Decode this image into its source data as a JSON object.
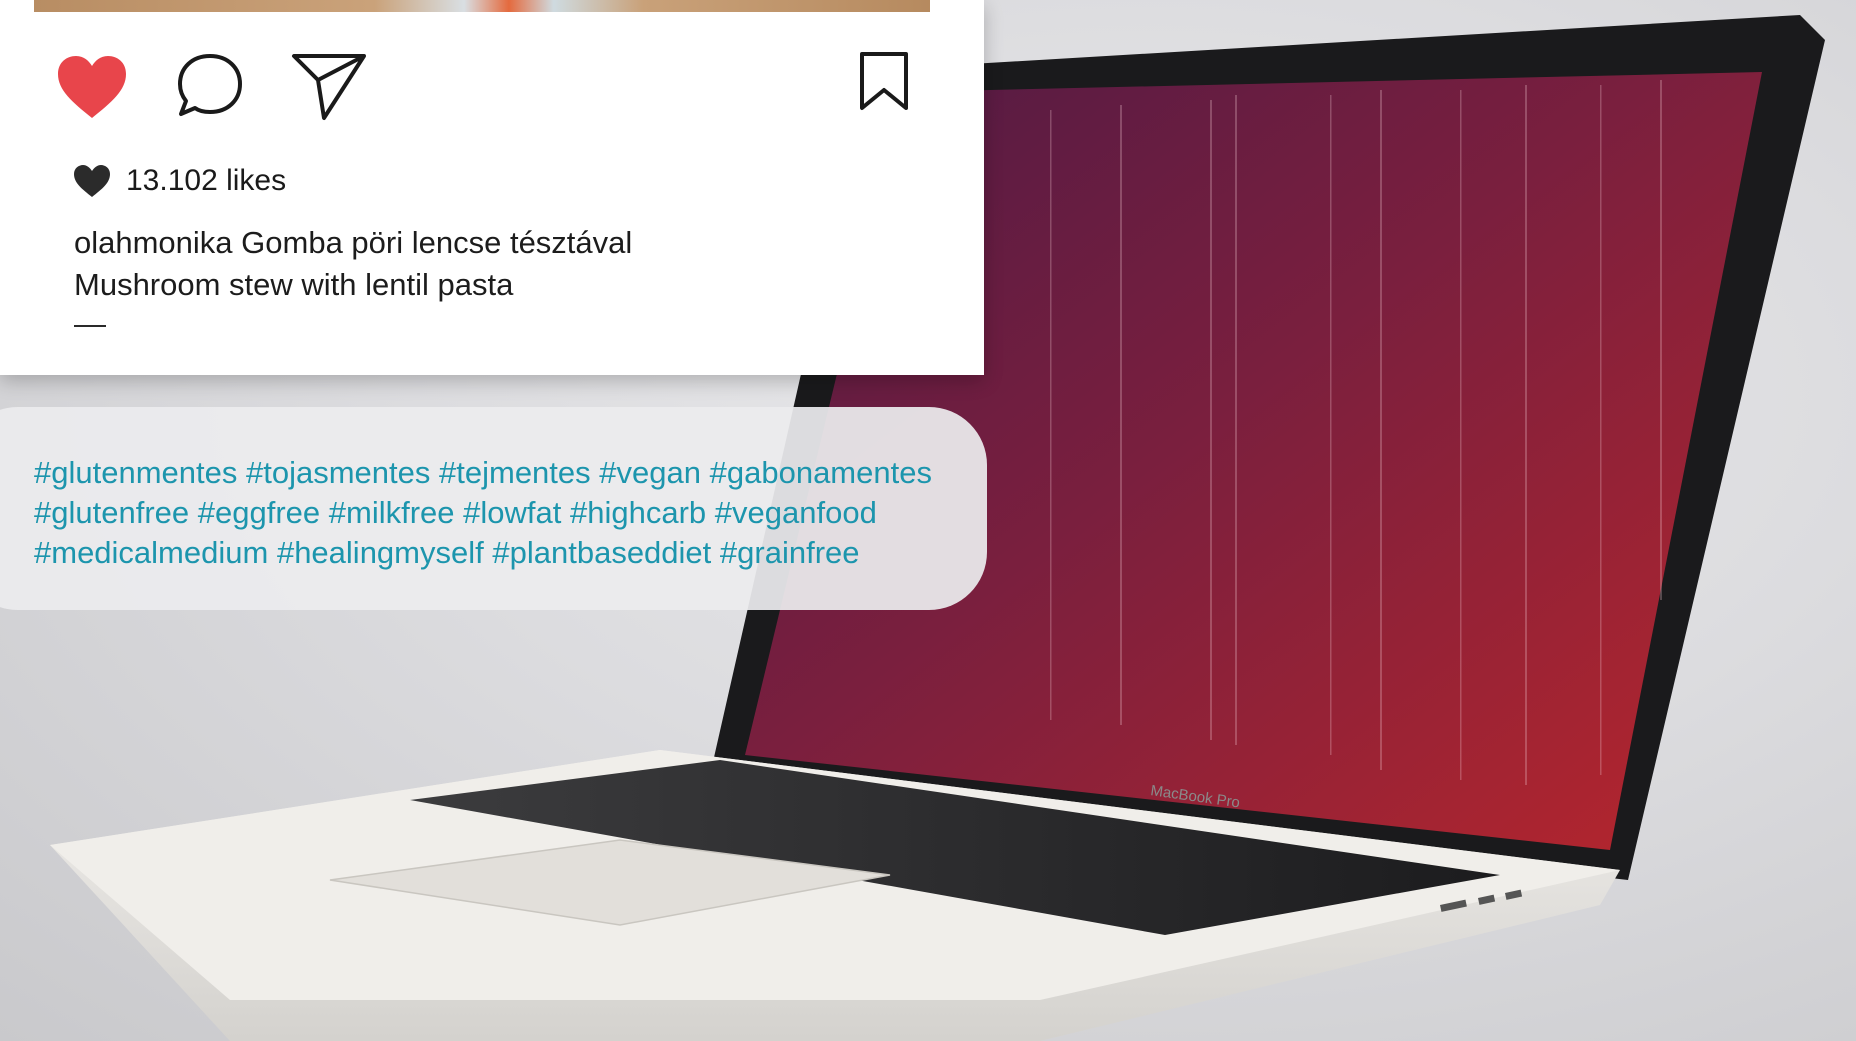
{
  "post": {
    "actions": {
      "like_icon": "heart-filled-icon",
      "comment_icon": "comment-bubble-icon",
      "share_icon": "paper-plane-icon",
      "save_icon": "bookmark-icon"
    },
    "likes_text": "13.102 likes",
    "caption": {
      "line1": "olahmonika Gomba pöri lencse tésztával",
      "line2": "Mushroom stew with lentil pasta",
      "divider": "—"
    }
  },
  "hashtags": {
    "lines": [
      [
        "#glutenmentes",
        "#tojasmentes",
        "#tejmentes",
        "#vegan",
        "#gabonamentes"
      ],
      [
        "#glutenfree",
        "#eggfree",
        "#milkfree",
        "#lowfat",
        "#highcarb",
        "#veganfood"
      ],
      [
        "#medicalmedium",
        "#healingmyself",
        "#plantbaseddiet",
        "#grainfree"
      ]
    ]
  },
  "background": {
    "laptop_brand": "MacBook Pro"
  },
  "colors": {
    "like_red": "#e8454b",
    "hashtag_teal": "#1c95ad",
    "screen_purple": "#6a1a3f",
    "screen_red": "#b8232a"
  }
}
